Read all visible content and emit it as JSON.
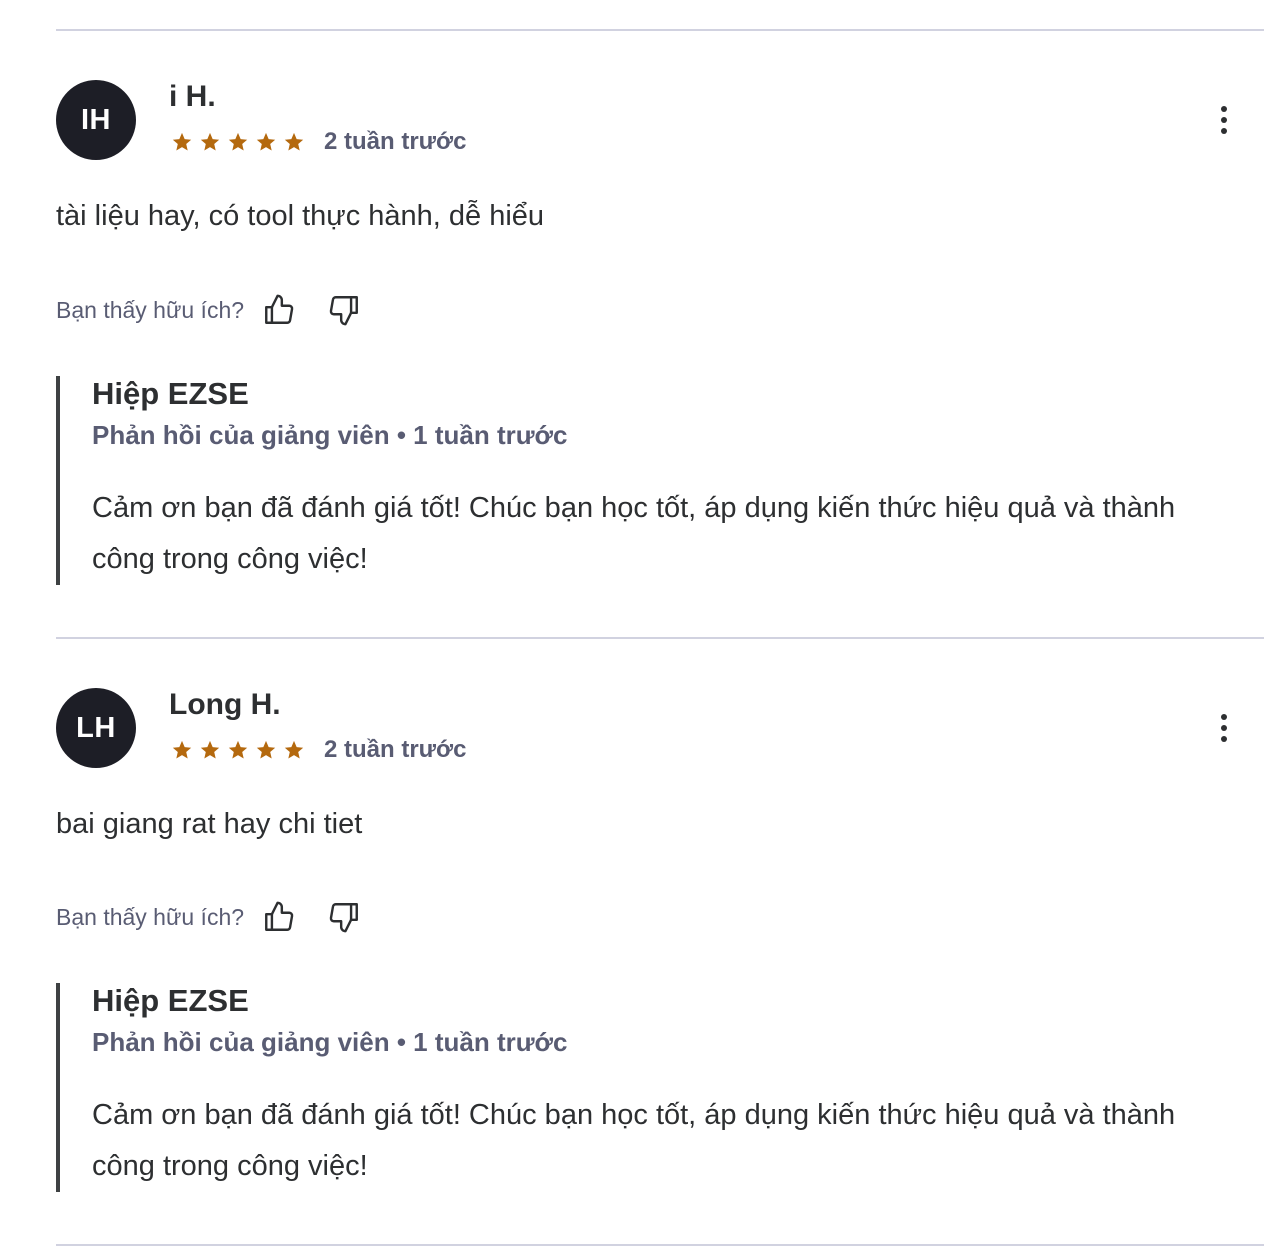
{
  "helpful_label": "Bạn thấy hữu ích?",
  "star_color": "#b4690e",
  "reviews": [
    {
      "avatar_initials": "IH",
      "name": "i H.",
      "rating": 5,
      "date": "2 tuần trước",
      "comment": "tài liệu hay, có tool thực hành, dễ hiểu",
      "reply": {
        "author": "Hiệp EZSE",
        "meta": "Phản hồi của giảng viên • 1 tuần trước",
        "text": "Cảm ơn bạn đã đánh giá tốt! Chúc bạn học tốt, áp dụng kiến thức hiệu quả và thành công trong công việc!"
      }
    },
    {
      "avatar_initials": "LH",
      "name": "Long H.",
      "rating": 5,
      "date": "2 tuần trước",
      "comment": "bai giang rat hay chi tiet",
      "reply": {
        "author": "Hiệp EZSE",
        "meta": "Phản hồi của giảng viên • 1 tuần trước",
        "text": "Cảm ơn bạn đã đánh giá tốt! Chúc bạn học tốt, áp dụng kiến thức hiệu quả và thành công trong công việc!"
      }
    }
  ]
}
